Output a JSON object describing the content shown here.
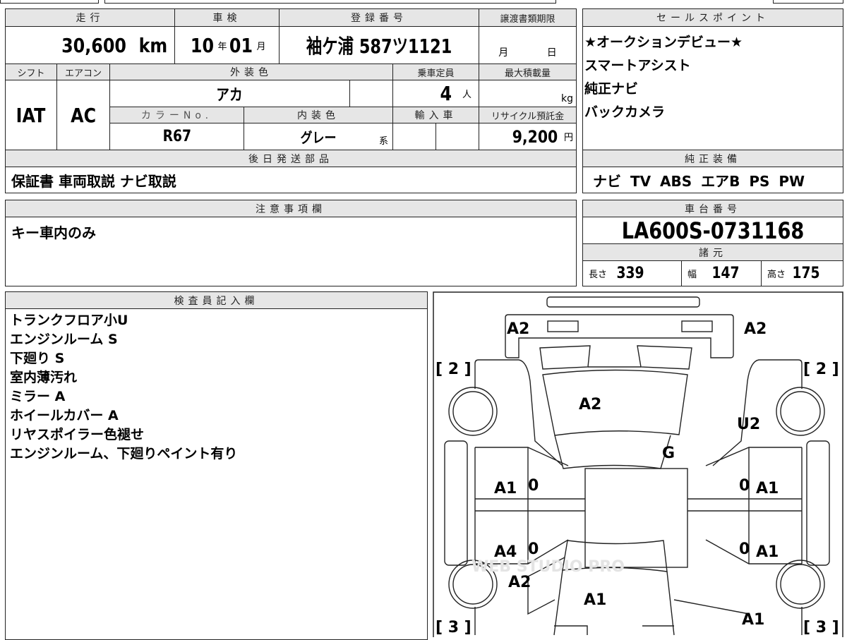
{
  "vehicle": {
    "headers": {
      "mileage": "走行",
      "inspection": "車検",
      "registration": "登録番号",
      "transfer_deadline": "譲渡書類期限",
      "shift": "シフト",
      "aircon": "エアコン",
      "exterior_color": "外装色",
      "capacity": "乗車定員",
      "max_load": "最大積載量",
      "color_no": "カラーNo.",
      "interior_color": "内装色",
      "imported": "輸入車",
      "recycle_fee": "リサイクル預託金",
      "later_parts": "後日発送部品"
    },
    "mileage": "30,600",
    "mileage_unit": "km",
    "inspection_year": "10",
    "year_unit": "年",
    "inspection_month": "01",
    "month_unit": "月",
    "registration": "袖ケ浦 587ツ1121",
    "deadline_month": "月",
    "deadline_day": "日",
    "shift": "IAT",
    "aircon": "AC",
    "exterior_color": "アカ",
    "capacity": "4",
    "capacity_unit": "人",
    "max_load_unit": "kg",
    "color_no": "R67",
    "interior_color": "グレー",
    "interior_suffix": "系",
    "recycle_fee": "9,200",
    "recycle_unit": "円",
    "later_parts": "保証書 車両取説 ナビ取説"
  },
  "sales_points": {
    "header": "セールスポイント",
    "items": [
      "★オークションデビュー★",
      "スマートアシスト",
      "純正ナビ",
      "バックカメラ"
    ]
  },
  "equipment": {
    "header": "純正装備",
    "value": "ナビ TV ABS エアB PS PW"
  },
  "notes": {
    "header": "注意事項欄",
    "value": "キー車内のみ"
  },
  "chassis": {
    "header": "車台番号",
    "value": "LA600S-0731168",
    "specs_header": "諸元",
    "length_label": "長さ",
    "length": "339",
    "width_label": "幅",
    "width": "147",
    "height_label": "高さ",
    "height": "175"
  },
  "inspector": {
    "header": "検査員記入欄",
    "lines": [
      "トランクフロア小U",
      "エンジンルーム S",
      "下廻り S",
      "室内薄汚れ",
      "ミラー A",
      "ホイールカバー A",
      "リヤスポイラー色褪せ",
      "エンジンルーム、下廻りペイント有り"
    ]
  },
  "diagram": {
    "marks": [
      "A2",
      "A2",
      "[ 2 ]",
      "[ 2 ]",
      "A2",
      "U2",
      "G",
      "A1",
      "0",
      "0",
      "A1",
      "A4",
      "0",
      "0",
      "A1",
      "A2",
      "A1",
      "A1",
      "[ 3 ]",
      "[ 3 ]"
    ],
    "watermark": "WEB STUDIO PRO"
  }
}
